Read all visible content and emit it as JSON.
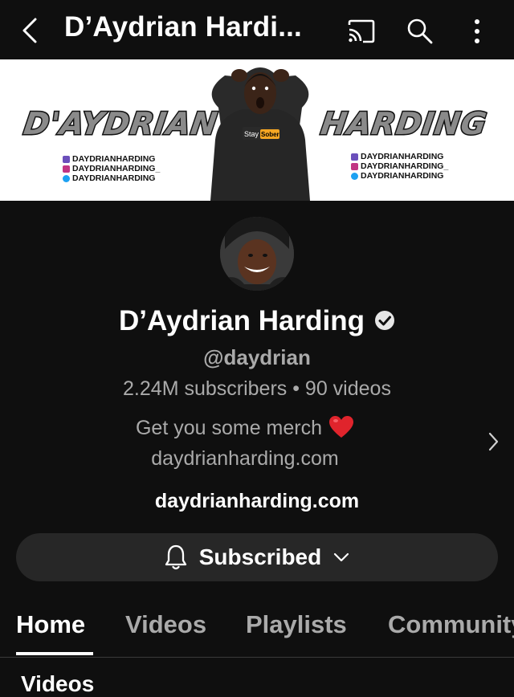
{
  "header": {
    "title": "D’Aydrian Hardi...",
    "back_icon": "back-chevron-icon",
    "cast_icon": "cast-icon",
    "search_icon": "search-icon",
    "more_icon": "more-vert-icon"
  },
  "banner": {
    "left_name": "D'AYDRIAN",
    "right_name": "HARDING",
    "shirt_text": "Stay Sober",
    "handles_left": [
      "DAYDRIANHARDING",
      "DAYDRIANHARDING_",
      "DAYDRIANHARDING"
    ],
    "handles_right": [
      "DAYDRIANHARDING",
      "DAYDRIANHARDING_",
      "DAYDRIANHARDING"
    ]
  },
  "channel": {
    "name": "D’Aydrian Harding",
    "handle": "@daydrian",
    "stats": "2.24M subscribers • 90 videos",
    "description_line1": "Get you some merch",
    "description_line2": "daydrianharding.com",
    "link": "daydrianharding.com"
  },
  "subscribe": {
    "label": "Subscribed"
  },
  "tabs": [
    {
      "label": "Home",
      "active": true
    },
    {
      "label": "Videos",
      "active": false
    },
    {
      "label": "Playlists",
      "active": false
    },
    {
      "label": "Community",
      "active": false
    }
  ],
  "section": {
    "title": "Videos"
  },
  "colors": {
    "background": "#0f0f0f",
    "secondary_text": "#aaaaaa",
    "button_bg": "#272727",
    "heart": "#e0242c"
  }
}
